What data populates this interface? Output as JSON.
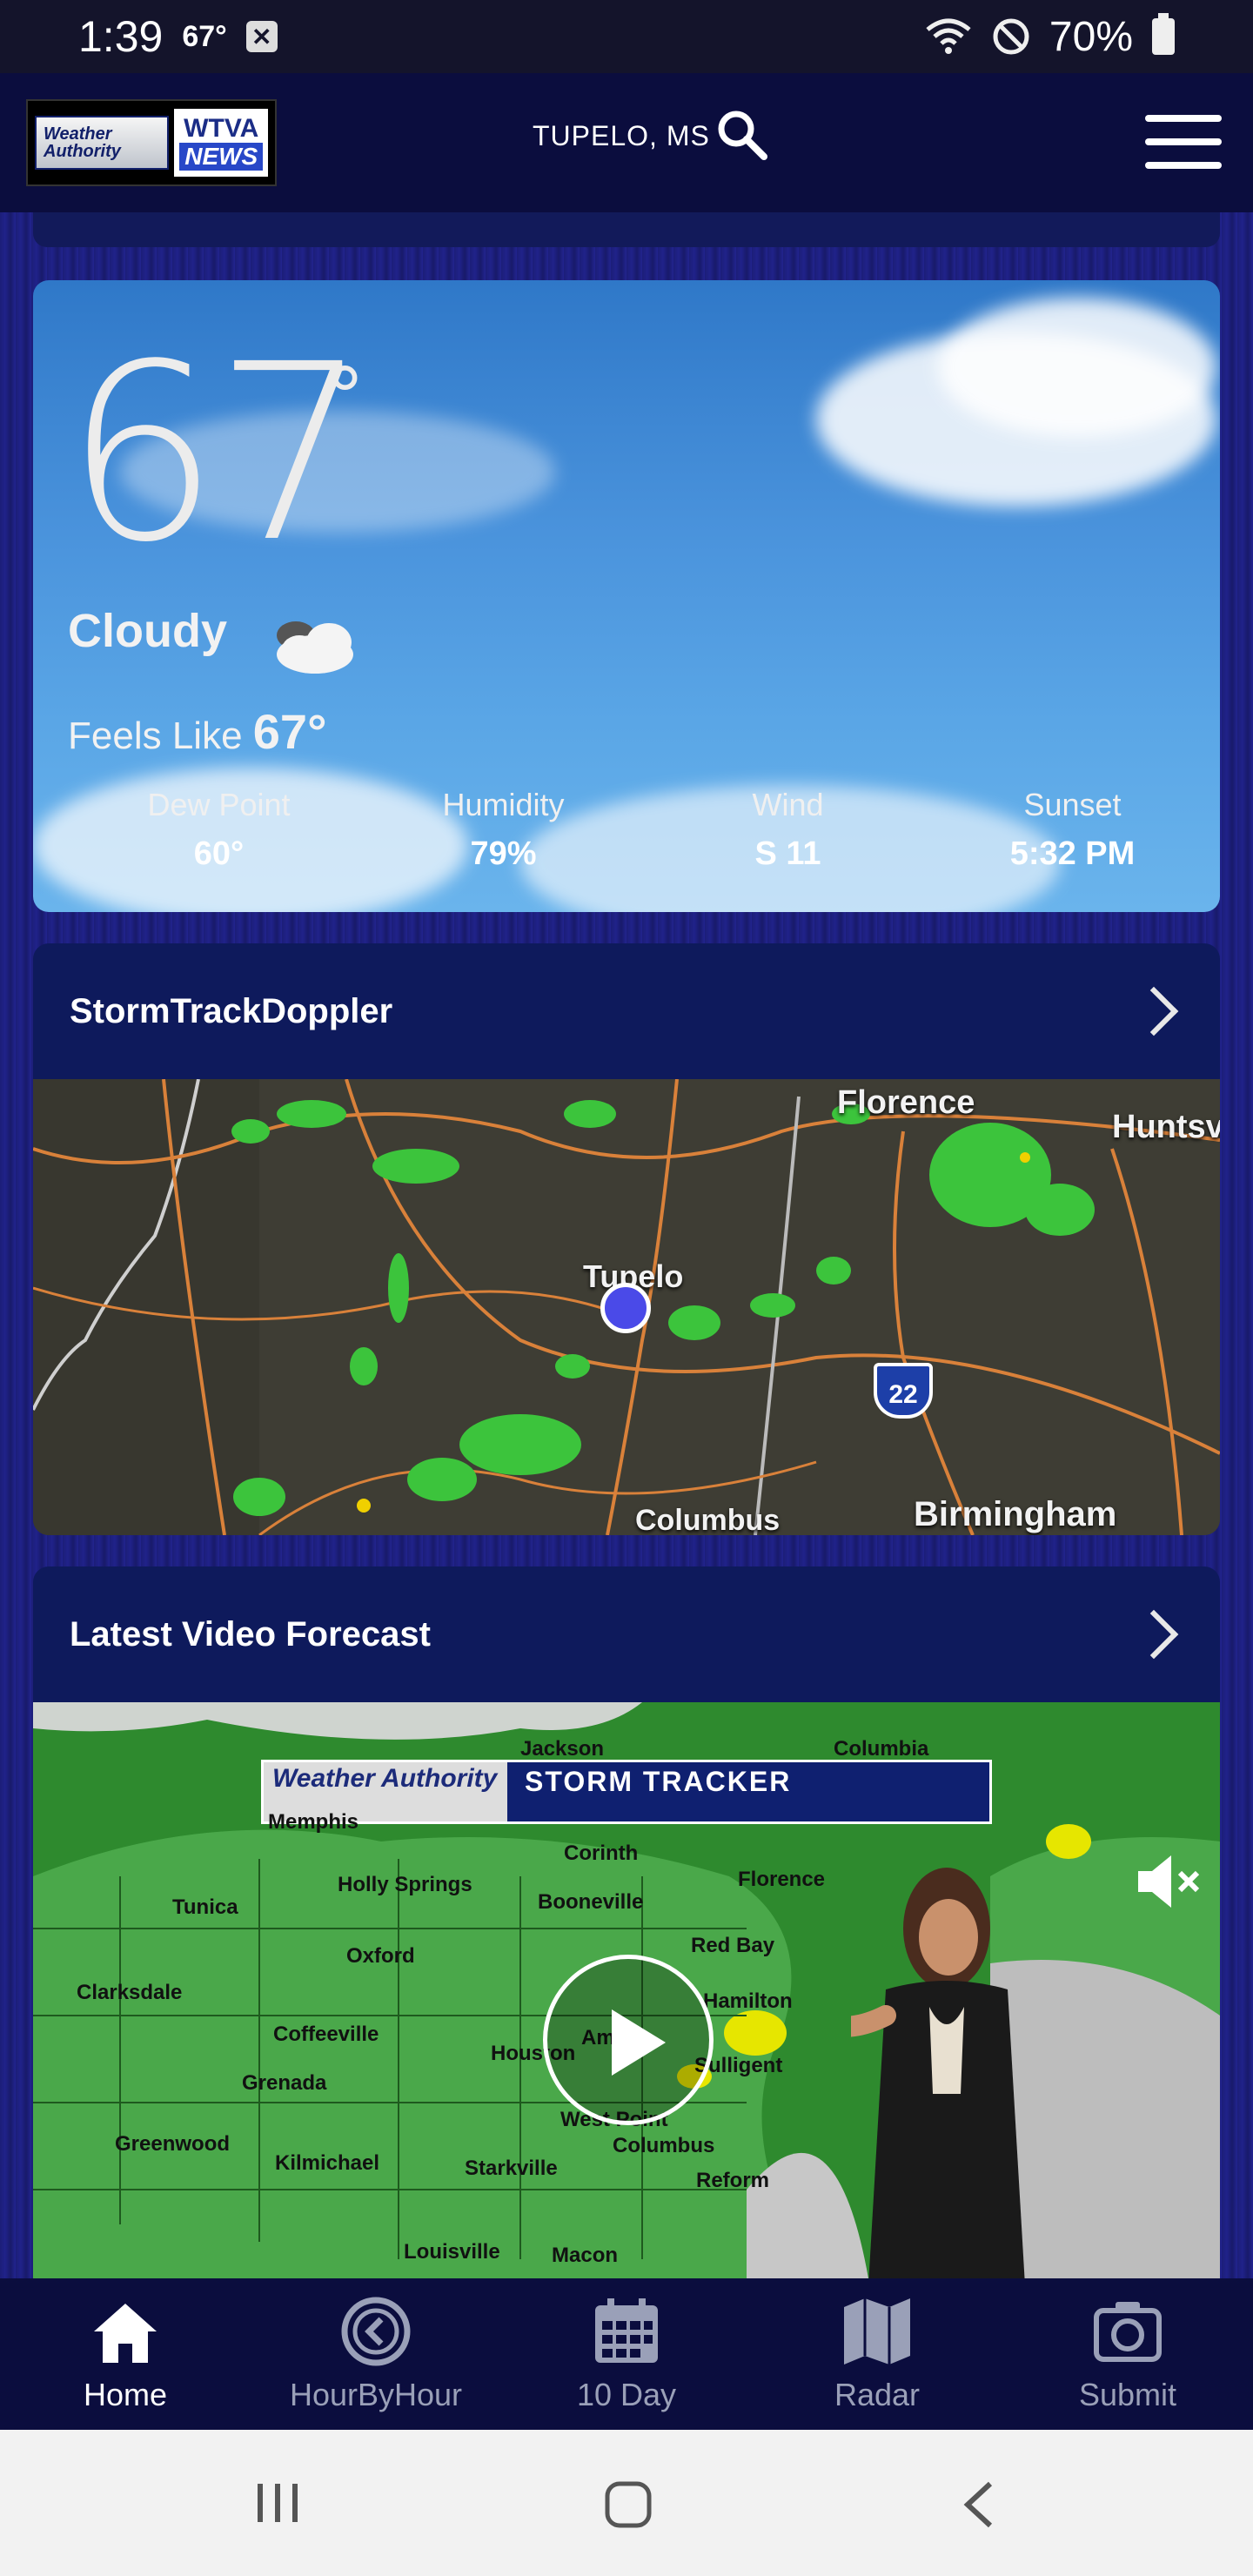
{
  "status": {
    "time": "1:39",
    "temp": "67°",
    "battery": "70%"
  },
  "header": {
    "logo_left": "Weather Authority",
    "logo_right_1": "WTVA",
    "logo_right_2": "NEWS",
    "location": "TUPELO, MS"
  },
  "conditions": {
    "temperature": "67",
    "degree": "°",
    "condition": "Cloudy",
    "feels_like_label": "Feels Like",
    "feels_like_value": "67°",
    "stats": [
      {
        "label": "Dew Point",
        "value": "60°"
      },
      {
        "label": "Humidity",
        "value": "79%"
      },
      {
        "label": "Wind",
        "value": "S 11"
      },
      {
        "label": "Sunset",
        "value": "5:32 PM"
      }
    ]
  },
  "radar_section": {
    "title": "StormTrackDoppler",
    "labels": {
      "florence": "Florence",
      "huntsville": "Huntsv",
      "tupelo": "Tupelo",
      "columbus": "Columbus",
      "birmingham": "Birmingham",
      "interstate": "22"
    }
  },
  "video_section": {
    "title": "Latest Video Forecast",
    "banner_left": "Weather Authority",
    "banner_title": "STORM TRACKER",
    "towns": [
      "Jackson",
      "Columbia",
      "Corinth",
      "Florence",
      "Holly Springs",
      "Booneville",
      "Tunica",
      "Oxford",
      "Red Bay",
      "Clarksdale",
      "Coffeeville",
      "Houston",
      "Hamilton",
      "Grenada",
      "Amory",
      "Sulligent",
      "Greenwood",
      "West Point",
      "Columbus",
      "Kilmichael",
      "Starkville",
      "Reform",
      "Louisville",
      "Macon",
      "Memphis"
    ]
  },
  "nav": {
    "items": [
      {
        "label": "Home"
      },
      {
        "label": "HourByHour"
      },
      {
        "label": "10 Day"
      },
      {
        "label": "Radar"
      },
      {
        "label": "Submit"
      }
    ]
  },
  "colors": {
    "header_bg": "#0b0d3e",
    "section_bg": "#0e1a5c",
    "radar_green": "#3cc43c",
    "location_dot": "#4a4ae8"
  }
}
